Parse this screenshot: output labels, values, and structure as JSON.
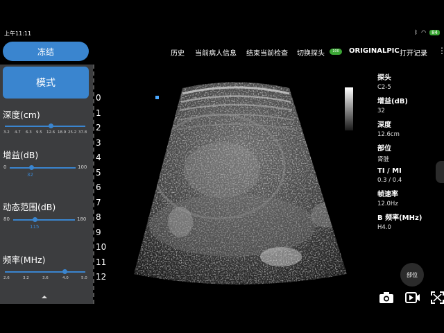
{
  "status": {
    "time": "上午11:11",
    "battery": "84"
  },
  "toolbar": {
    "freeze_label": "冻结",
    "menu": {
      "history": "历史",
      "current_patient": "当前病人信息",
      "end_exam": "结束当前检查",
      "switch_probe": "切换探头",
      "toggle": "100",
      "original_pic": "ORIGINALPIC",
      "open_records": "打开记录"
    }
  },
  "left_panel": {
    "mode_label": "模式",
    "depth": {
      "label": "深度(cm)",
      "ticks": [
        "3.2",
        "4.7",
        "6.3",
        "9.5",
        "12.6",
        "18.9",
        "25.2",
        "37.8"
      ],
      "selected": "12.6"
    },
    "gain": {
      "label": "增益(dB)",
      "min": "0",
      "max": "100",
      "value": "32"
    },
    "dynamic_range": {
      "label": "动态范围(dB)",
      "min": "80",
      "max": "180",
      "value": "115"
    },
    "frequency": {
      "label": "频率(MHz)",
      "ticks": [
        "2.6",
        "3.2",
        "3.6",
        "4.0",
        "5.0"
      ],
      "selected": "4.0"
    }
  },
  "depth_scale": [
    "0",
    "1",
    "2",
    "3",
    "4",
    "5",
    "6",
    "7",
    "8",
    "9",
    "10",
    "11",
    "12"
  ],
  "params": [
    {
      "label": "探头",
      "value": "C2-5"
    },
    {
      "label": "增益(dB)",
      "value": "32"
    },
    {
      "label": "深度",
      "value": "12.6cm"
    },
    {
      "label": "部位",
      "value": "肾脏"
    },
    {
      "label": "TI / MI",
      "value": "0.3 / 0.4"
    },
    {
      "label": "帧速率",
      "value": "12.0Hz"
    },
    {
      "label": "B 频率(MHz)",
      "value": "H4.0"
    }
  ],
  "site_button": "部位",
  "icons": [
    "camera-icon",
    "video-icon",
    "fullscreen-icon",
    "more-icon",
    "collapse-icon",
    "wifi-icon",
    "bluetooth-icon"
  ],
  "colors": {
    "accent": "#3a85cf",
    "panel": "#3c3d3f",
    "toggle": "#3ba635"
  }
}
